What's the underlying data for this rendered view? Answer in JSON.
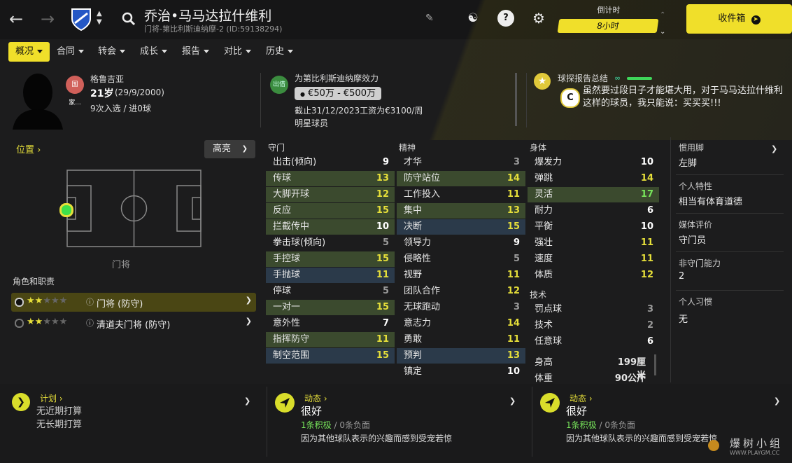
{
  "header": {
    "title": "乔治•马马达拉什维利",
    "subtitle": "门将-第比利斯迪纳摩-2 (ID:59138294)",
    "countdown_label": "倒计时",
    "countdown_value": "8小时",
    "inbox_label": "收件箱"
  },
  "menu": [
    {
      "label": "概况"
    },
    {
      "label": "合同"
    },
    {
      "label": "转会"
    },
    {
      "label": "成长"
    },
    {
      "label": "报告"
    },
    {
      "label": "对比"
    },
    {
      "label": "历史"
    }
  ],
  "profile": {
    "nationality": "格鲁吉亚",
    "nation_badge": "国家...",
    "age": "21岁",
    "dob": "(29/9/2000)",
    "caps": "9次入选 / 进0球",
    "loan_badge": "出借",
    "playing_for": "为第比利斯迪纳摩效力",
    "value": "€50万 - €500万",
    "wage": "截止31/12/2023工资为€3100/周",
    "status": "明星球员",
    "scout_title": "球探报告总结",
    "scout_grade": "C",
    "scout_text": "虽然要过段日子才能堪大用，对于马马达拉什维利这样的球员，我只能说：买买买!!!"
  },
  "position": {
    "heading": "位置",
    "highlight": "高亮",
    "name": "门将",
    "roles_heading": "角色和职责",
    "roles": [
      {
        "name": "门将 (防守)",
        "stars": 2
      },
      {
        "name": "清道夫门将 (防守)",
        "stars": 2
      }
    ]
  },
  "attributes": {
    "goalkeeping": {
      "title": "守门",
      "items": [
        {
          "n": "出击(倾向)",
          "v": "9"
        },
        {
          "n": "传球",
          "v": "13"
        },
        {
          "n": "大脚开球",
          "v": "12"
        },
        {
          "n": "反应",
          "v": "15"
        },
        {
          "n": "拦截传中",
          "v": "10"
        },
        {
          "n": "拳击球(倾向)",
          "v": "5"
        },
        {
          "n": "手控球",
          "v": "15"
        },
        {
          "n": "手抛球",
          "v": "11"
        },
        {
          "n": "停球",
          "v": "5"
        },
        {
          "n": "一对一",
          "v": "15"
        },
        {
          "n": "意外性",
          "v": "7"
        },
        {
          "n": "指挥防守",
          "v": "11"
        },
        {
          "n": "制空范围",
          "v": "15"
        }
      ]
    },
    "mental": {
      "title": "精神",
      "items": [
        {
          "n": "才华",
          "v": "3"
        },
        {
          "n": "防守站位",
          "v": "14"
        },
        {
          "n": "工作投入",
          "v": "11"
        },
        {
          "n": "集中",
          "v": "13"
        },
        {
          "n": "决断",
          "v": "15"
        },
        {
          "n": "领导力",
          "v": "9"
        },
        {
          "n": "侵略性",
          "v": "5"
        },
        {
          "n": "视野",
          "v": "11"
        },
        {
          "n": "团队合作",
          "v": "12"
        },
        {
          "n": "无球跑动",
          "v": "3"
        },
        {
          "n": "意志力",
          "v": "14"
        },
        {
          "n": "勇敢",
          "v": "11"
        },
        {
          "n": "预判",
          "v": "13"
        },
        {
          "n": "镇定",
          "v": "10"
        }
      ]
    },
    "physical": {
      "title": "身体",
      "items": [
        {
          "n": "爆发力",
          "v": "10"
        },
        {
          "n": "弹跳",
          "v": "14"
        },
        {
          "n": "灵活",
          "v": "17"
        },
        {
          "n": "耐力",
          "v": "6"
        },
        {
          "n": "平衡",
          "v": "10"
        },
        {
          "n": "强壮",
          "v": "11"
        },
        {
          "n": "速度",
          "v": "11"
        },
        {
          "n": "体质",
          "v": "12"
        }
      ]
    },
    "technical": {
      "title": "技术",
      "items": [
        {
          "n": "罚点球",
          "v": "3"
        },
        {
          "n": "技术",
          "v": "2"
        },
        {
          "n": "任意球",
          "v": "6"
        }
      ]
    },
    "height_label": "身高",
    "height": "199厘米",
    "weight_label": "体重",
    "weight": "90公斤"
  },
  "info": {
    "foot_label": "惯用脚",
    "foot": "左脚",
    "trait_label": "个人特性",
    "trait": "相当有体育道德",
    "media_label": "媒体评价",
    "media": "守门员",
    "nongk_label": "非守门能力",
    "nongk": "2",
    "habits_label": "个人习惯",
    "habits": "无"
  },
  "bottom": {
    "plan_title": "计划",
    "plan_lines": [
      "无近期打算",
      "无长期打算"
    ],
    "panels": [
      {
        "title": "动态",
        "status": "很好",
        "positive": "1条积极",
        "separator": "/",
        "negative": "0条负面",
        "detail": "因为其他球队表示的兴趣而感到受宠若惊"
      },
      {
        "title": "动态",
        "status": "很好",
        "positive": "1条积极",
        "separator": "/",
        "negative": "0条负面",
        "detail": "因为其他球队表示的兴趣而感到受宠若惊"
      }
    ]
  },
  "watermark": "爆树小组",
  "watermark_url": "WWW.PLAYGM.CC",
  "colors": {
    "accent": "#f0df2a",
    "green": "#77e45a",
    "yellow": "#e6df3a"
  }
}
